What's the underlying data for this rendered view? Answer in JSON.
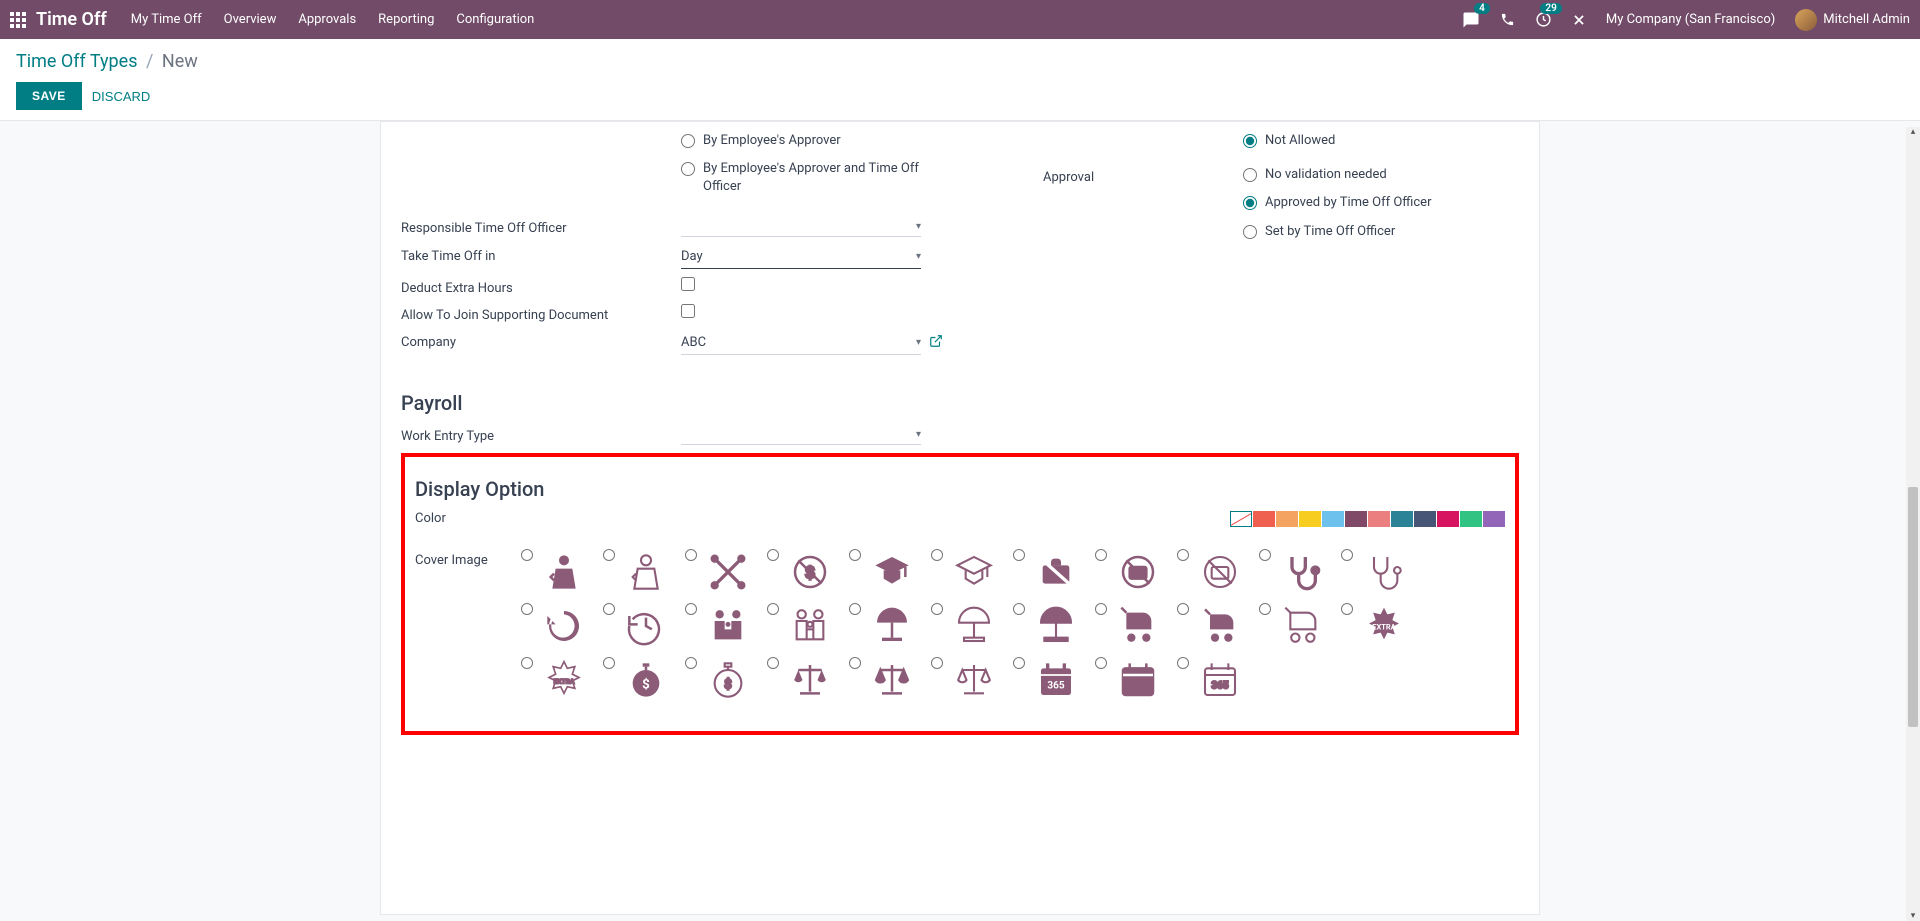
{
  "topbar": {
    "brand": "Time Off",
    "nav": [
      "My Time Off",
      "Overview",
      "Approvals",
      "Reporting",
      "Configuration"
    ],
    "msg_badge": "4",
    "rem_badge": "29",
    "company": "My Company (San Francisco)",
    "user": "Mitchell Admin"
  },
  "breadcrumb": {
    "parent": "Time Off Types",
    "sep": "/",
    "current": "New"
  },
  "actions": {
    "save": "SAVE",
    "discard": "DISCARD"
  },
  "form": {
    "approver_radios": [
      "By Employee's Approver",
      "By Employee's Approver and Time Off Officer"
    ],
    "fields": {
      "responsible": "Responsible Time Off Officer",
      "take_in": "Take Time Off in",
      "take_in_value": "Day",
      "deduct": "Deduct Extra Hours",
      "allow_doc": "Allow To Join Supporting Document",
      "company": "Company",
      "company_value": "ABC"
    },
    "right_radios": {
      "top": [
        "Not Allowed"
      ],
      "approval_label": "Approval",
      "approval": [
        "No validation needed",
        "Approved by Time Off Officer",
        "Set by Time Off Officer"
      ]
    },
    "payroll_title": "Payroll",
    "work_entry": "Work Entry Type",
    "display_title": "Display Option",
    "color_label": "Color",
    "cover_label": "Cover Image"
  },
  "colors": [
    "none",
    "#F06050",
    "#F4A460",
    "#F7CD1F",
    "#6CC1ED",
    "#814968",
    "#EB7E7F",
    "#2C8397",
    "#475577",
    "#D6145F",
    "#30C381",
    "#9365B8"
  ],
  "cover_icons": [
    "injury",
    "injury-outline",
    "crossed-swords",
    "no-dollar",
    "grad-cap-solid",
    "grad-cap-outline",
    "briefcase-off-solid",
    "briefcase-off-circle",
    "briefcase-off-outline",
    "stethoscope-solid",
    "stethoscope-outline",
    "",
    "history-solid",
    "history-outline",
    "family-solid",
    "family-outline",
    "umbrella-stand-solid",
    "umbrella-stand-outline",
    "umbrella-alt",
    "stroller-solid",
    "stroller-dark",
    "stroller-outline",
    "extra-burst",
    "",
    "extra-burst-outline",
    "stopwatch-dollar",
    "stopwatch-dollar-outline",
    "scales-solid",
    "scales-mid",
    "scales-outline",
    "calendar-365-solid",
    "calendar-365-mid",
    "calendar-365-outline",
    "",
    "",
    ""
  ]
}
